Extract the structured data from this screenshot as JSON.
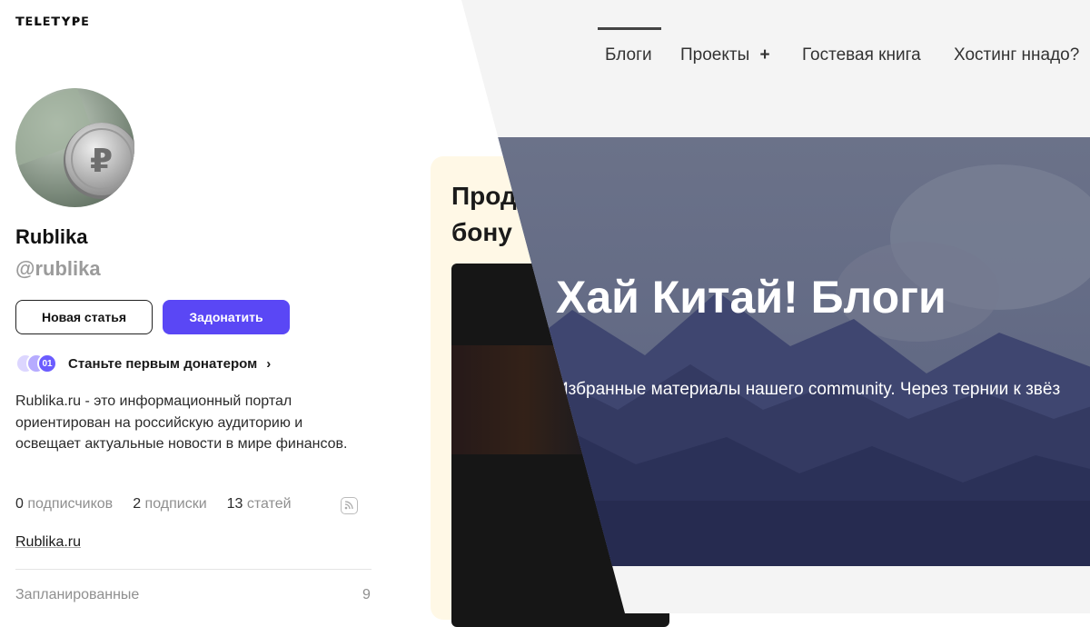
{
  "teletype": {
    "logo": "ᴛᴇʟᴇᴛʏᴘᴇ",
    "profile": {
      "name": "Rublika",
      "handle": "@rublika",
      "avatar_icon": "ruble-coin-avatar"
    },
    "buttons": {
      "new_article": "Новая статья",
      "donate": "Задонатить"
    },
    "donors": {
      "badge": "01",
      "text": "Станьте первым донатером",
      "colors": [
        "#d9d3ff",
        "#b5aaff",
        "#7b6cff"
      ]
    },
    "description": "Rublika.ru - это информационный портал ориентирован на российскую аудиторию и освещает актуальные новости в мире финансов.",
    "stats": [
      {
        "count": "0",
        "label": "подписчиков"
      },
      {
        "count": "2",
        "label": "подписки"
      },
      {
        "count": "13",
        "label": "статей"
      }
    ],
    "website": "Rublika.ru",
    "planned": {
      "label": "Запланированные",
      "count": "9"
    },
    "promo": {
      "title_line1": "Прод",
      "title_line2": "бону"
    },
    "accent": "#5a47f5"
  },
  "blog": {
    "nav": [
      "Блоги",
      "Проекты",
      "Гостевая книга",
      "Хостинг ннадо?"
    ],
    "nav_plus": "+",
    "hero_title": "Хай Китай! Блоги",
    "hero_subtitle": "Избранные материалы нашего community. Через тернии к звёз",
    "hero_bg": "#626a84"
  }
}
